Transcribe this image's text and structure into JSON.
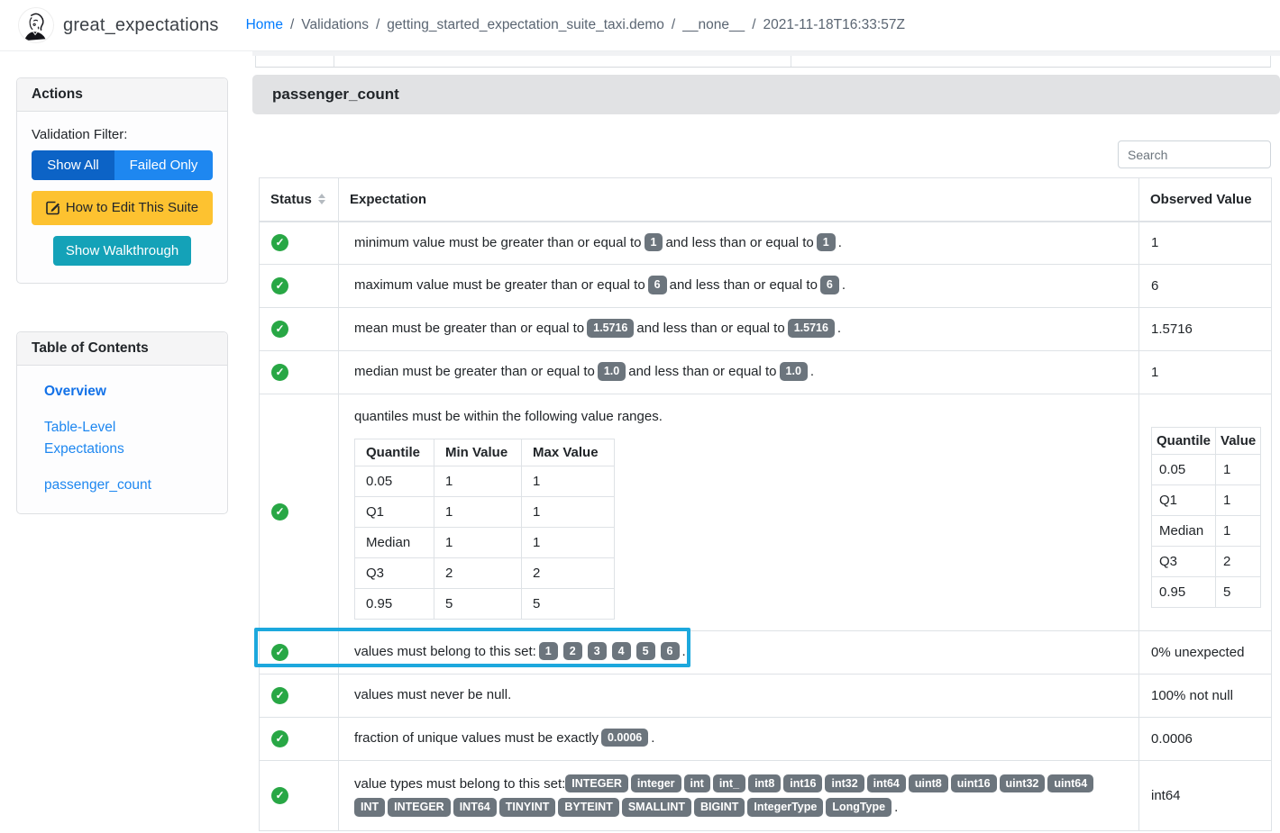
{
  "colors": {
    "primary": "#1e87f0",
    "primary-active": "#0c63c6",
    "warning": "#fdc230",
    "info": "#14a2b8",
    "success": "#28a745",
    "badge": "#6c757d",
    "highlight": "#1ca8dd",
    "link": "#007bff",
    "toc-link": "#1e87f0",
    "toc-active": "#1372e8"
  },
  "nav": {
    "brand": "great_expectations",
    "breadcrumb": {
      "home": "Home",
      "sep": "/",
      "items": [
        "Validations",
        "getting_started_expectation_suite_taxi.demo",
        "__none__",
        "2021-11-18T16:33:57Z"
      ]
    }
  },
  "sidebar": {
    "actions": {
      "title": "Actions",
      "filter_label": "Validation Filter:",
      "show_all": "Show All",
      "failed_only": "Failed Only",
      "edit_suite": "How to Edit This Suite",
      "walkthrough": "Show Walkthrough"
    },
    "toc": {
      "title": "Table of Contents",
      "overview": "Overview",
      "table_level": "Table-Level Expectations",
      "column": "passenger_count"
    }
  },
  "main": {
    "section_title": "passenger_count",
    "search_placeholder": "Search",
    "table": {
      "headers": {
        "status": "Status",
        "expectation": "Expectation",
        "observed": "Observed Value"
      },
      "rows": [
        {
          "pre": "minimum value must be greater than or equal to",
          "badge1": "1",
          "mid": "and less than or equal to",
          "badge2": "1",
          "post": ".",
          "observed": "1"
        },
        {
          "pre": "maximum value must be greater than or equal to",
          "badge1": "6",
          "mid": "and less than or equal to",
          "badge2": "6",
          "post": ".",
          "observed": "6"
        },
        {
          "pre": "mean must be greater than or equal to",
          "badge1": "1.5716",
          "mid": "and less than or equal to",
          "badge2": "1.5716",
          "post": ".",
          "observed": "1.5716"
        },
        {
          "pre": "median must be greater than or equal to",
          "badge1": "1.0",
          "mid": "and less than or equal to",
          "badge2": "1.0",
          "post": ".",
          "observed": "1"
        }
      ],
      "quantiles_row": {
        "text": "quantiles must be within the following value ranges.",
        "table": {
          "headers": [
            "Quantile",
            "Min Value",
            "Max Value"
          ],
          "rows": [
            [
              "0.05",
              "1",
              "1"
            ],
            [
              "Q1",
              "1",
              "1"
            ],
            [
              "Median",
              "1",
              "1"
            ],
            [
              "Q3",
              "2",
              "2"
            ],
            [
              "0.95",
              "5",
              "5"
            ]
          ]
        },
        "observed_table": {
          "headers": [
            "Quantile",
            "Value"
          ],
          "rows": [
            [
              "0.05",
              "1"
            ],
            [
              "Q1",
              "1"
            ],
            [
              "Median",
              "1"
            ],
            [
              "Q3",
              "2"
            ],
            [
              "0.95",
              "5"
            ]
          ]
        }
      },
      "set_row": {
        "pre": "values must belong to this set:",
        "values": [
          "1",
          "2",
          "3",
          "4",
          "5",
          "6"
        ],
        "post": ".",
        "observed": "0% unexpected"
      },
      "null_row": {
        "text": "values must never be null.",
        "observed": "100% not null"
      },
      "unique_row": {
        "pre": "fraction of unique values must be exactly",
        "badge": "0.0006",
        "post": ".",
        "observed": "0.0006"
      },
      "types_row": {
        "pre": "value types must belong to this set:",
        "values": [
          "INTEGER",
          "integer",
          "int",
          "int_",
          "int8",
          "int16",
          "int32",
          "int64",
          "uint8",
          "uint16",
          "uint32",
          "uint64",
          "INT",
          "INTEGER",
          "INT64",
          "TINYINT",
          "BYTEINT",
          "SMALLINT",
          "BIGINT",
          "IntegerType",
          "LongType"
        ],
        "post": ".",
        "observed": "int64"
      }
    }
  }
}
